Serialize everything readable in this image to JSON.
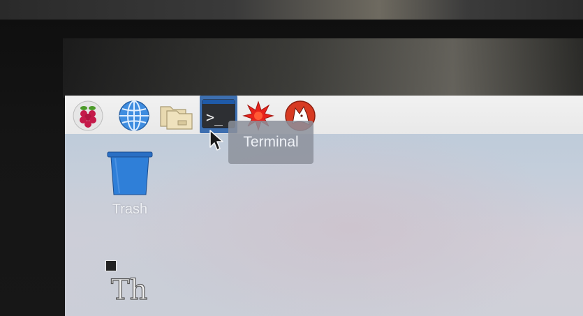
{
  "taskbar": {
    "items": [
      {
        "name": "menu",
        "icon": "raspberry-pi-icon"
      },
      {
        "name": "browser",
        "icon": "globe-icon"
      },
      {
        "name": "file-manager",
        "icon": "folder-icon"
      },
      {
        "name": "terminal",
        "icon": "terminal-icon",
        "glyph": ">_",
        "active": true
      },
      {
        "name": "wolfram",
        "icon": "wolfram-icon"
      },
      {
        "name": "mathematica",
        "icon": "mathematica-icon"
      }
    ]
  },
  "tooltip": {
    "text": "Terminal"
  },
  "desktop": {
    "icons": [
      {
        "label": "Trash",
        "icon": "trash-icon"
      },
      {
        "label": "",
        "icon": "text-font-shortcut-icon",
        "glyph": "Th"
      }
    ]
  },
  "colors": {
    "taskbar_bg": "#eeeeee",
    "terminal_highlight": "#3d6fb0",
    "trash_blue": "#2f7fd8",
    "tooltip_bg": "#8c919b"
  }
}
